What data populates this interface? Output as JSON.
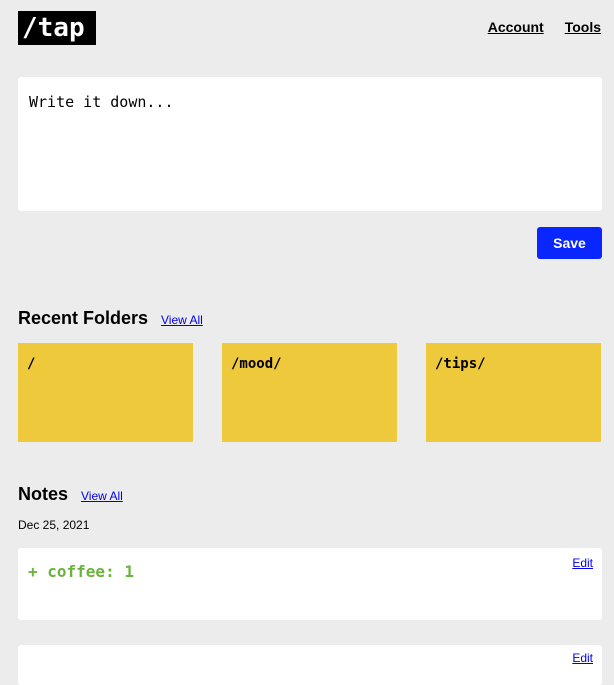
{
  "header": {
    "logo": "/tap",
    "nav": [
      "Account",
      "Tools"
    ]
  },
  "editor": {
    "placeholder": "Write it down...",
    "save_label": "Save"
  },
  "recent_folders": {
    "title": "Recent Folders",
    "view_all": "View All",
    "folders": [
      "/",
      "/mood/",
      "/tips/"
    ]
  },
  "notes": {
    "title": "Notes",
    "view_all": "View All",
    "date": "Dec 25, 2021",
    "items": [
      {
        "text": "+ coffee: 1",
        "edit": "Edit"
      },
      {
        "text": "",
        "edit": "Edit"
      }
    ]
  },
  "colors": {
    "background": "#ececec",
    "save_button": "#0a26ff",
    "folder": "#eec93c",
    "note_text": "#6bb33d",
    "link": "#0000ee"
  }
}
